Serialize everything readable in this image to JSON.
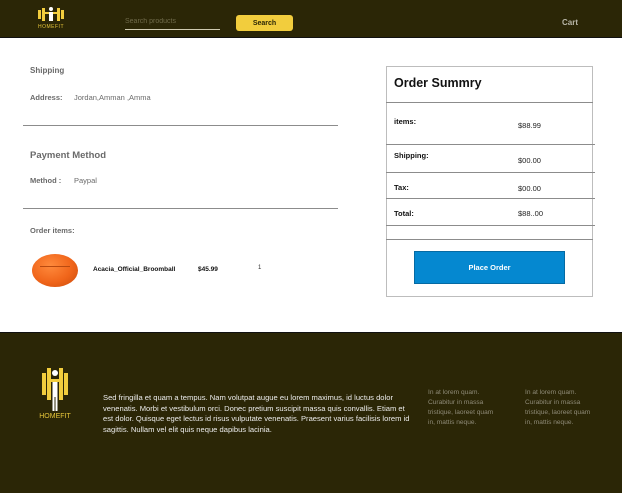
{
  "header": {
    "brand": "HOMEFIT",
    "search_placeholder": "Search products",
    "search_button": "Search",
    "cart": "Cart"
  },
  "shipping": {
    "heading": "Shipping",
    "address_label": "Address:",
    "address_value": "Jordan,Amman ,Amma"
  },
  "payment": {
    "heading": "Payment Method",
    "method_label": "Method :",
    "method_value": "Paypal"
  },
  "order_items": {
    "heading": "Order items:",
    "items": [
      {
        "name": "Acacia_Official_Broomball",
        "price": "$45.99",
        "qty": "1"
      }
    ]
  },
  "summary": {
    "title": "Order Summry",
    "rows": [
      {
        "label": "items:",
        "value": "$88.99"
      },
      {
        "label": "Shipping:",
        "value": "$00.00"
      },
      {
        "label": "Tax:",
        "value": "$00.00"
      },
      {
        "label": "Total:",
        "value": "$88..00"
      }
    ],
    "place_order": "Place Order"
  },
  "footer": {
    "brand": "HOMEFIT",
    "text": "Sed fringilla et quam a tempus. Nam volutpat augue eu lorem maximus, id luctus dolor venenatis. Morbi et vestibulum orci. Donec pretium suscipit massa quis convallis. Etiam et est dolor. Quisque eget lectus id risus vulputate venenatis. Praesent varius facilisis lorem id sagittis. Nullam vel elit quis neque dapibus lacinia.",
    "col1": "In at lorem quam. Curabitur in massa tristique, laoreet quam in, mattis neque.",
    "col2": "In at lorem quam. Curabitur in massa tristique, laoreet quam in, mattis neque."
  },
  "colors": {
    "header_bg": "#2b2606",
    "accent_yellow": "#f2cd3d",
    "place_order_blue": "#0588d0"
  },
  "icons": [
    "homefit-logo-icon"
  ]
}
